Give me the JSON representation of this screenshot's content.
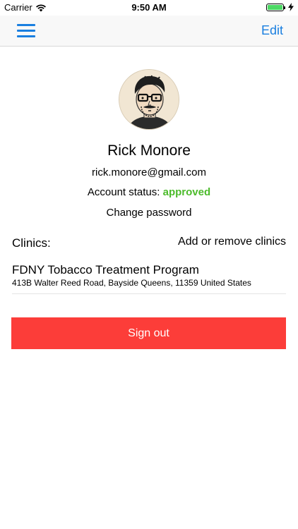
{
  "status_bar": {
    "carrier": "Carrier",
    "time": "9:50 AM",
    "icons": [
      "wifi-icon",
      "battery-icon",
      "charging-icon"
    ]
  },
  "nav": {
    "menu_icon": "hamburger-menu-icon",
    "edit_label": "Edit",
    "accent_color": "#1a7fe0"
  },
  "profile": {
    "avatar_icon": "cartoon-avatar",
    "name": "Rick Monore",
    "email": "rick.monore@gmail.com",
    "status_label": "Account status:",
    "status_value": "approved",
    "status_color": "#4cbb2b",
    "change_password": "Change password"
  },
  "clinics": {
    "label": "Clinics:",
    "manage_label": "Add or remove clinics",
    "items": [
      {
        "name": "FDNY Tobacco Treatment Program",
        "address": "413B Walter Reed Road, Bayside Queens, 11359 United States"
      }
    ]
  },
  "actions": {
    "sign_out": "Sign out",
    "sign_out_color": "#fc3d39"
  }
}
